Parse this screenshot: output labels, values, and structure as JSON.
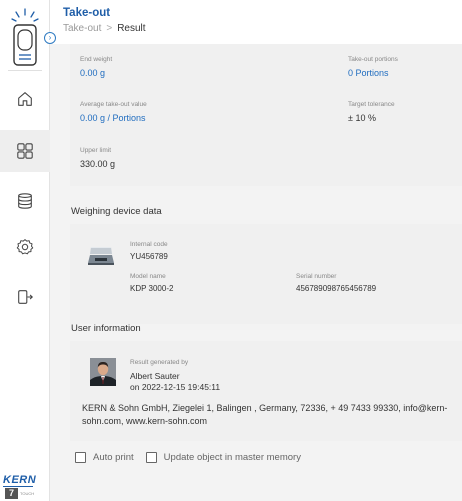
{
  "header": {
    "title": "Take-out",
    "breadcrumb": {
      "parent": "Take-out",
      "separator": ">",
      "current": "Result"
    }
  },
  "summary": {
    "end_weight": {
      "label": "End weight",
      "value": "0.00 g"
    },
    "take_out_portions": {
      "label": "Take-out portions",
      "value": "0 Portions"
    },
    "average_value": {
      "label": "Average take-out value",
      "value": "0.00 g / Portions"
    },
    "target_tolerance": {
      "label": "Target tolerance",
      "value": "± 10 %"
    },
    "upper_limit": {
      "label": "Upper limit",
      "value": "330.00 g"
    }
  },
  "device": {
    "section_title": "Weighing device data",
    "internal_code_label": "Internal code",
    "internal_code": "YU456789",
    "model_name_label": "Model name",
    "model_name": "KDP 3000-2",
    "serial_number_label": "Serial number",
    "serial_number": "456789098765456789"
  },
  "user": {
    "section_title": "User information",
    "generated_by_label": "Result generated by",
    "name": "Albert Sauter",
    "generated_on": "on 2022-12-15 19:45:11",
    "company_line1": "KERN & Sohn GmbH, Ziegelei 1, Balingen , Germany, 72336, + 49 7433 99330, info@kern-",
    "company_line2": "sohn.com, www.kern-sohn.com"
  },
  "options": {
    "auto_print": "Auto print",
    "update_master": "Update object in master memory"
  },
  "brand": {
    "name": "KERN",
    "badge": "7",
    "sub": "TOUCH"
  },
  "colors": {
    "accent": "#1f5ea8",
    "link": "#1f6cbf",
    "background": "#f3f3f3"
  },
  "icons": {
    "device": "scale-terminal-icon",
    "collapse": "chevron-right-icon",
    "nav": [
      "home-icon",
      "grid-icon",
      "database-icon",
      "gear-icon",
      "logout-icon"
    ]
  }
}
